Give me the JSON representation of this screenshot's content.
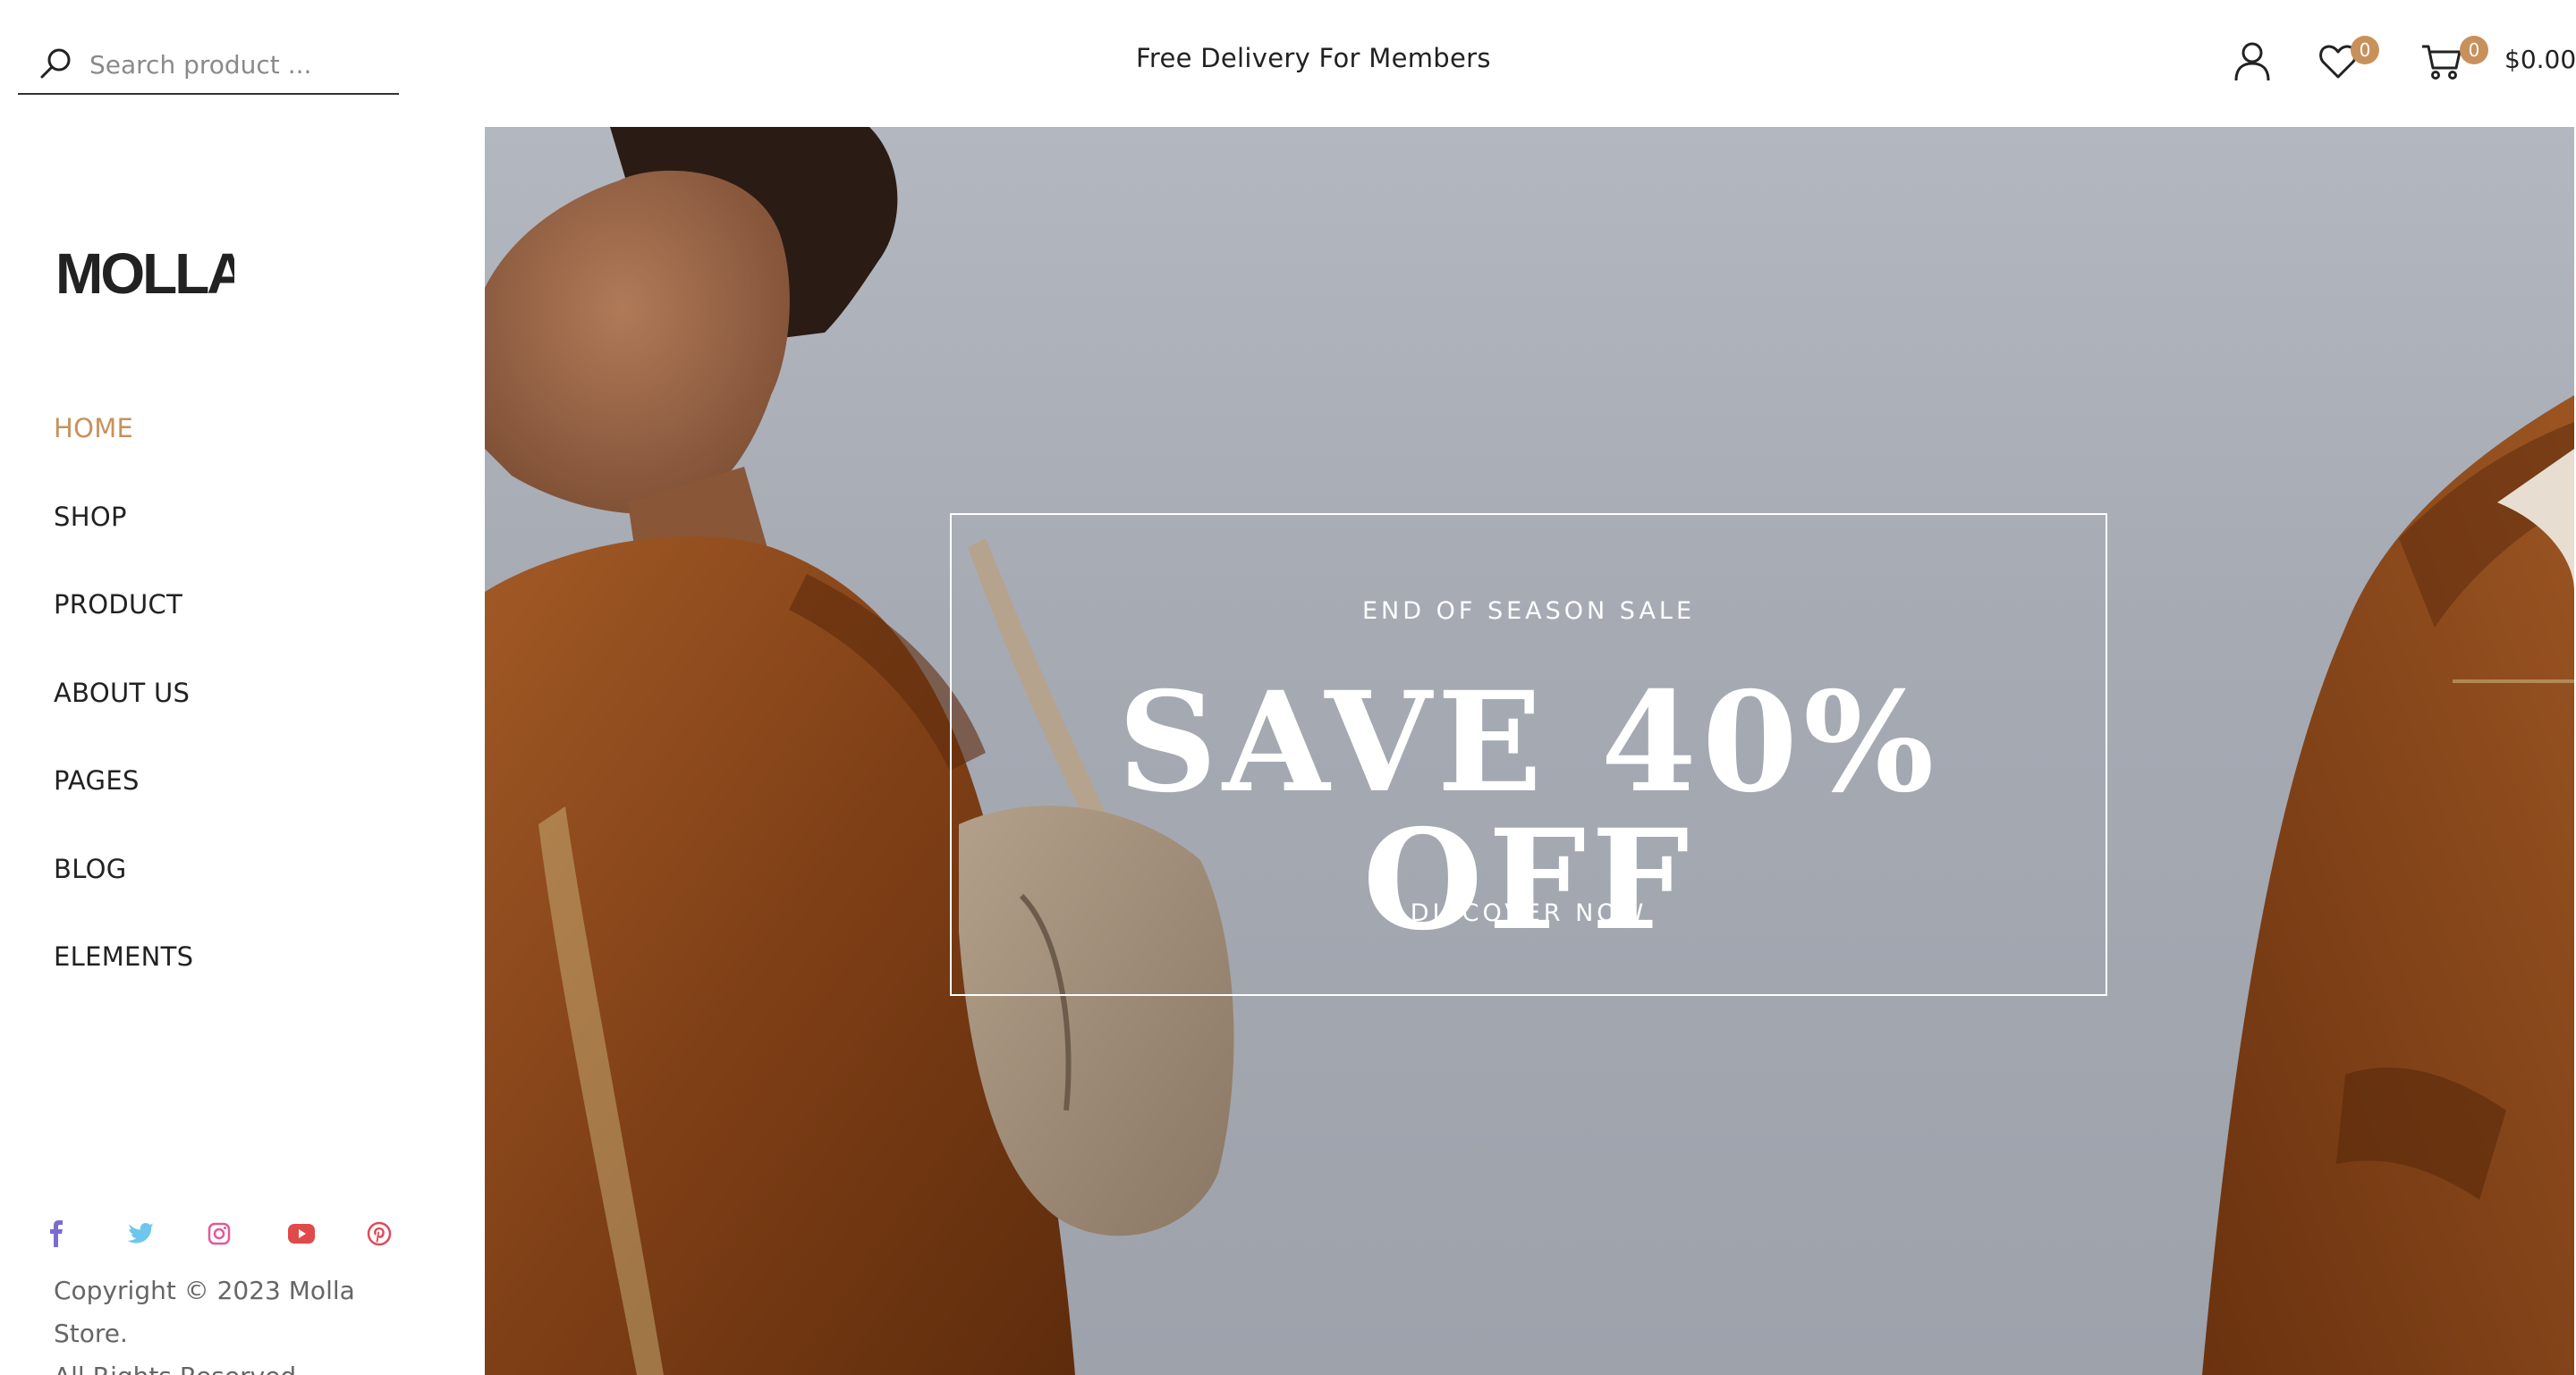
{
  "header": {
    "search": {
      "placeholder": "Search product ...",
      "value": ""
    },
    "promo_text": "Free Delivery For Members",
    "wishlist_count": "0",
    "cart_count": "0",
    "cart_total": "$0.00"
  },
  "sidebar": {
    "logo_text": "MOLLA",
    "nav": [
      {
        "label": "HOME",
        "active": true
      },
      {
        "label": "SHOP"
      },
      {
        "label": "PRODUCT"
      },
      {
        "label": "ABOUT US"
      },
      {
        "label": "PAGES"
      },
      {
        "label": "BLOG"
      },
      {
        "label": "ELEMENTS"
      }
    ],
    "social": [
      {
        "icon": "facebook-icon",
        "color": "#7b6bd0"
      },
      {
        "icon": "twitter-icon",
        "color": "#6ec6ec"
      },
      {
        "icon": "instagram-icon",
        "color": "#e05a9b"
      },
      {
        "icon": "youtube-icon",
        "color": "#e04a4a"
      },
      {
        "icon": "pinterest-icon",
        "color": "#e04a5a"
      }
    ],
    "copyright_line1": "Copyright © 2023 Molla Store.",
    "copyright_line2": "All Rights Reserved."
  },
  "hero": {
    "eyebrow": "END OF SEASON SALE",
    "title": "SAVE 40% OFF",
    "cta": "DISCOVER NOW"
  },
  "colors": {
    "accent": "#c8915c",
    "text": "#222222",
    "hero_bg": "#a6aab3",
    "jacket": "#8a4a1e"
  }
}
